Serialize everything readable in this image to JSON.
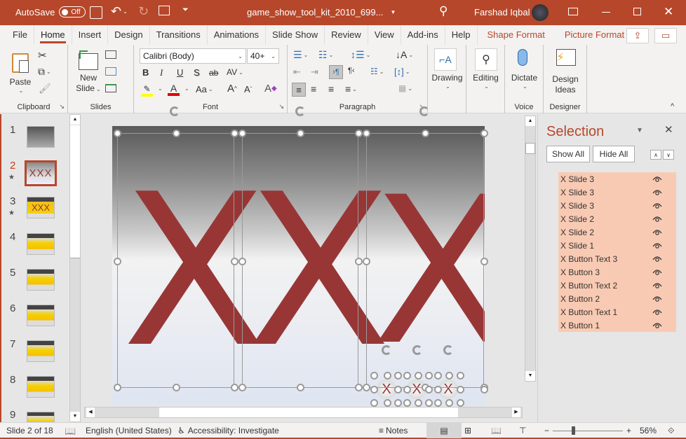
{
  "titlebar": {
    "autosave_label": "AutoSave",
    "autosave_state": "Off",
    "filename": "game_show_tool_kit_2010_699...",
    "user_name": "Farshad Iqbal",
    "icons": [
      "save-icon",
      "undo-icon",
      "redo-icon",
      "present-icon",
      "customize-icon",
      "search-icon",
      "ribbon-display-icon",
      "minimize-icon",
      "maximize-icon",
      "close-icon"
    ]
  },
  "menu": {
    "tabs": [
      "File",
      "Home",
      "Insert",
      "Design",
      "Transitions",
      "Animations",
      "Slide Show",
      "Review",
      "View",
      "Add-ins",
      "Help"
    ],
    "active_tab": "Home",
    "contextual_tabs": [
      "Shape Format",
      "Picture Format"
    ]
  },
  "ribbon": {
    "clipboard": {
      "label": "Clipboard",
      "paste": "Paste"
    },
    "slides": {
      "label": "Slides",
      "new_slide_line1": "New",
      "new_slide_line2": "Slide"
    },
    "font": {
      "label": "Font",
      "font_name": "Calibri (Body)",
      "font_size": "40+",
      "bold": "B",
      "italic": "I",
      "underline": "U",
      "shadow": "S",
      "strike": "ab",
      "spacing": "AV",
      "case": "Aa",
      "grow": "A",
      "shrink": "A",
      "highlight_color": "#ffff00",
      "font_color": "#e00000"
    },
    "paragraph": {
      "label": "Paragraph"
    },
    "drawing": {
      "label": "Drawing"
    },
    "editing": {
      "label": "Editing"
    },
    "voice": {
      "label": "Voice",
      "dictate": "Dictate"
    },
    "designer": {
      "label": "Designer",
      "design_ideas_line1": "Design",
      "design_ideas_line2": "Ideas"
    }
  },
  "slides_pane": {
    "thumbnails": [
      {
        "num": "1",
        "star": false,
        "selected": false
      },
      {
        "num": "2",
        "star": true,
        "selected": true
      },
      {
        "num": "3",
        "star": true,
        "selected": false
      },
      {
        "num": "4",
        "star": false,
        "selected": false
      },
      {
        "num": "5",
        "star": false,
        "selected": false
      },
      {
        "num": "6",
        "star": false,
        "selected": false
      },
      {
        "num": "7",
        "star": false,
        "selected": false
      },
      {
        "num": "8",
        "star": false,
        "selected": false
      },
      {
        "num": "9",
        "star": false,
        "selected": false
      }
    ]
  },
  "slide": {
    "big_x": [
      "X",
      "X",
      "X"
    ],
    "small_x": [
      "X",
      "X",
      "X"
    ],
    "x_color": "#983636"
  },
  "selection_pane": {
    "title": "Selection",
    "show_all": "Show All",
    "hide_all": "Hide All",
    "items": [
      "X Slide 3",
      "X Slide 3",
      "X Slide 3",
      "X Slide 2",
      "X Slide 2",
      "X Slide 1",
      "X Button Text 3",
      "X Button 3",
      "X Button Text 2",
      "X Button 2",
      "X Button Text 1",
      "X Button 1"
    ],
    "highlight_color": "#f9cab3"
  },
  "statusbar": {
    "slide_info": "Slide 2 of 18",
    "language": "English (United States)",
    "accessibility": "Accessibility: Investigate",
    "notes": "Notes",
    "zoom_minus": "−",
    "zoom_plus": "+",
    "zoom": "56%",
    "zoom_fraction": 0.56
  },
  "accent_color": "#b7472a"
}
